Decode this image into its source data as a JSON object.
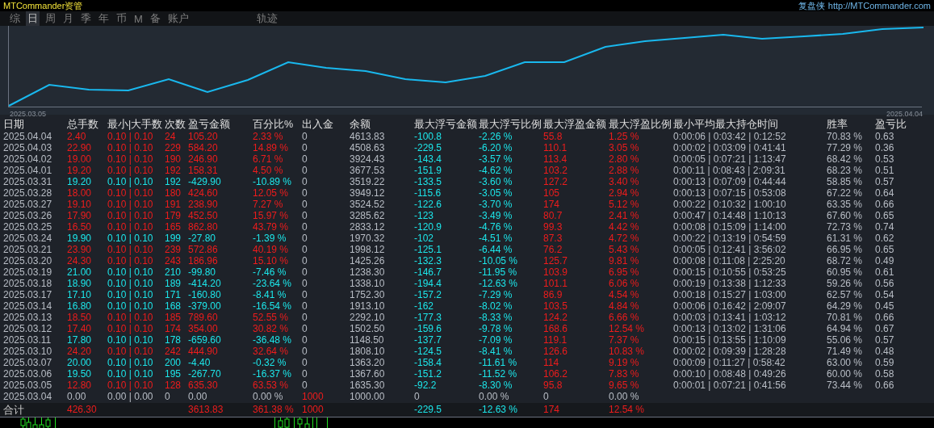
{
  "title": "MTCommander资管",
  "header_right": {
    "label": "复盘侠",
    "link": "http://MTCommander.com"
  },
  "tabs": [
    {
      "label": "综",
      "selected": false
    },
    {
      "label": "日",
      "selected": true
    },
    {
      "label": "周",
      "selected": false
    },
    {
      "label": "月",
      "selected": false
    },
    {
      "label": "季",
      "selected": false
    },
    {
      "label": "年",
      "selected": false
    },
    {
      "label": "币",
      "selected": false
    },
    {
      "label": "M",
      "selected": false
    },
    {
      "label": "备",
      "selected": false
    },
    {
      "label": "账户",
      "selected": false
    }
  ],
  "track_tab": {
    "label": "轨迹",
    "selected": false
  },
  "chart": {
    "start_label": "2025.03.05",
    "end_label": "2025.04.04"
  },
  "table": {
    "columns": [
      "日期",
      "总手数",
      "最小|大手数",
      "次数",
      "盈亏金额",
      "百分比%",
      "出入金",
      "余额",
      "最大浮亏金额",
      "最大浮亏比例",
      "最大浮盈金额",
      "最大浮盈比例",
      "最小平均最大持仓时间",
      "胜率",
      "盈亏比"
    ],
    "rows": [
      {
        "kind": "profit",
        "deposit": false,
        "cells": [
          "2025.04.04",
          "2.40",
          "0.10 | 0.10",
          "24",
          "105.20",
          "2.33 %",
          "0",
          "4613.83",
          "-100.8",
          "-2.26 %",
          "55.8",
          "1.25 %",
          "0:00:06 | 0:03:42 | 0:12:52",
          "70.83 %",
          "0.63"
        ]
      },
      {
        "kind": "profit",
        "deposit": false,
        "cells": [
          "2025.04.03",
          "22.90",
          "0.10 | 0.10",
          "229",
          "584.20",
          "14.89 %",
          "0",
          "4508.63",
          "-229.5",
          "-6.20 %",
          "110.1",
          "3.05 %",
          "0:00:02 | 0:03:09 | 0:41:41",
          "77.29 %",
          "0.36"
        ]
      },
      {
        "kind": "profit",
        "deposit": false,
        "cells": [
          "2025.04.02",
          "19.00",
          "0.10 | 0.10",
          "190",
          "246.90",
          "6.71 %",
          "0",
          "3924.43",
          "-143.4",
          "-3.57 %",
          "113.4",
          "2.80 %",
          "0:00:05 | 0:07:21 | 1:13:47",
          "68.42 %",
          "0.53"
        ]
      },
      {
        "kind": "profit",
        "deposit": false,
        "cells": [
          "2025.04.01",
          "19.20",
          "0.10 | 0.10",
          "192",
          "158.31",
          "4.50 %",
          "0",
          "3677.53",
          "-151.9",
          "-4.62 %",
          "103.2",
          "2.88 %",
          "0:00:11 | 0:08:43 | 2:09:31",
          "68.23 %",
          "0.51"
        ]
      },
      {
        "kind": "loss",
        "deposit": false,
        "cells": [
          "2025.03.31",
          "19.20",
          "0.10 | 0.10",
          "192",
          "-429.90",
          "-10.89 %",
          "0",
          "3519.22",
          "-133.5",
          "-3.60 %",
          "127.2",
          "3.40 %",
          "0:00:13 | 0:07:09 | 0:44:44",
          "58.85 %",
          "0.57"
        ]
      },
      {
        "kind": "profit",
        "deposit": false,
        "cells": [
          "2025.03.28",
          "18.00",
          "0.10 | 0.10",
          "180",
          "424.60",
          "12.05 %",
          "0",
          "3949.12",
          "-115.6",
          "-3.05 %",
          "105",
          "2.94 %",
          "0:00:13 | 0:07:15 | 0:53:08",
          "67.22 %",
          "0.64"
        ]
      },
      {
        "kind": "profit",
        "deposit": false,
        "cells": [
          "2025.03.27",
          "19.10",
          "0.10 | 0.10",
          "191",
          "238.90",
          "7.27 %",
          "0",
          "3524.52",
          "-122.6",
          "-3.70 %",
          "174",
          "5.12 %",
          "0:00:22 | 0:10:32 | 1:00:10",
          "63.35 %",
          "0.66"
        ]
      },
      {
        "kind": "profit",
        "deposit": false,
        "cells": [
          "2025.03.26",
          "17.90",
          "0.10 | 0.10",
          "179",
          "452.50",
          "15.97 %",
          "0",
          "3285.62",
          "-123",
          "-3.49 %",
          "80.7",
          "2.41 %",
          "0:00:47 | 0:14:48 | 1:10:13",
          "67.60 %",
          "0.65"
        ]
      },
      {
        "kind": "profit",
        "deposit": false,
        "cells": [
          "2025.03.25",
          "16.50",
          "0.10 | 0.10",
          "165",
          "862.80",
          "43.79 %",
          "0",
          "2833.12",
          "-120.9",
          "-4.76 %",
          "99.3",
          "4.42 %",
          "0:00:08 | 0:15:09 | 1:14:00",
          "72.73 %",
          "0.74"
        ]
      },
      {
        "kind": "loss",
        "deposit": false,
        "cells": [
          "2025.03.24",
          "19.90",
          "0.10 | 0.10",
          "199",
          "-27.80",
          "-1.39 %",
          "0",
          "1970.32",
          "-102",
          "-4.51 %",
          "87.3",
          "4.72 %",
          "0:00:22 | 0:13:19 | 0:54:59",
          "61.31 %",
          "0.62"
        ]
      },
      {
        "kind": "profit",
        "deposit": false,
        "cells": [
          "2025.03.21",
          "23.90",
          "0.10 | 0.10",
          "239",
          "572.86",
          "40.19 %",
          "0",
          "1998.12",
          "-125.1",
          "-6.44 %",
          "76.2",
          "5.43 %",
          "0:00:05 | 0:12:41 | 3:56:02",
          "66.95 %",
          "0.65"
        ]
      },
      {
        "kind": "profit",
        "deposit": false,
        "cells": [
          "2025.03.20",
          "24.30",
          "0.10 | 0.10",
          "243",
          "186.96",
          "15.10 %",
          "0",
          "1425.26",
          "-132.3",
          "-10.05 %",
          "125.7",
          "9.81 %",
          "0:00:08 | 0:11:08 | 2:25:20",
          "68.72 %",
          "0.49"
        ]
      },
      {
        "kind": "loss",
        "deposit": false,
        "cells": [
          "2025.03.19",
          "21.00",
          "0.10 | 0.10",
          "210",
          "-99.80",
          "-7.46 %",
          "0",
          "1238.30",
          "-146.7",
          "-11.95 %",
          "103.9",
          "6.95 %",
          "0:00:15 | 0:10:55 | 0:53:25",
          "60.95 %",
          "0.61"
        ]
      },
      {
        "kind": "loss",
        "deposit": false,
        "cells": [
          "2025.03.18",
          "18.90",
          "0.10 | 0.10",
          "189",
          "-414.20",
          "-23.64 %",
          "0",
          "1338.10",
          "-194.4",
          "-12.63 %",
          "101.1",
          "6.06 %",
          "0:00:19 | 0:13:38 | 1:12:33",
          "59.26 %",
          "0.56"
        ]
      },
      {
        "kind": "loss",
        "deposit": false,
        "cells": [
          "2025.03.17",
          "17.10",
          "0.10 | 0.10",
          "171",
          "-160.80",
          "-8.41 %",
          "0",
          "1752.30",
          "-157.2",
          "-7.29 %",
          "86.9",
          "4.54 %",
          "0:00:18 | 0:15:27 | 1:03:00",
          "62.57 %",
          "0.54"
        ]
      },
      {
        "kind": "loss",
        "deposit": false,
        "cells": [
          "2025.03.14",
          "16.80",
          "0.10 | 0.10",
          "168",
          "-379.00",
          "-16.54 %",
          "0",
          "1913.10",
          "-162",
          "-8.02 %",
          "103.5",
          "4.84 %",
          "0:00:06 | 0:16:42 | 2:09:07",
          "64.29 %",
          "0.45"
        ]
      },
      {
        "kind": "profit",
        "deposit": false,
        "cells": [
          "2025.03.13",
          "18.50",
          "0.10 | 0.10",
          "185",
          "789.60",
          "52.55 %",
          "0",
          "2292.10",
          "-177.3",
          "-8.33 %",
          "124.2",
          "6.66 %",
          "0:00:03 | 0:13:41 | 1:03:12",
          "70.81 %",
          "0.66"
        ]
      },
      {
        "kind": "profit",
        "deposit": false,
        "cells": [
          "2025.03.12",
          "17.40",
          "0.10 | 0.10",
          "174",
          "354.00",
          "30.82 %",
          "0",
          "1502.50",
          "-159.6",
          "-9.78 %",
          "168.6",
          "12.54 %",
          "0:00:13 | 0:13:02 | 1:31:06",
          "64.94 %",
          "0.67"
        ]
      },
      {
        "kind": "loss",
        "deposit": false,
        "cells": [
          "2025.03.11",
          "17.80",
          "0.10 | 0.10",
          "178",
          "-659.60",
          "-36.48 %",
          "0",
          "1148.50",
          "-137.7",
          "-7.09 %",
          "119.1",
          "7.37 %",
          "0:00:15 | 0:13:55 | 1:10:09",
          "55.06 %",
          "0.57"
        ]
      },
      {
        "kind": "profit",
        "deposit": false,
        "cells": [
          "2025.03.10",
          "24.20",
          "0.10 | 0.10",
          "242",
          "444.90",
          "32.64 %",
          "0",
          "1808.10",
          "-124.5",
          "-8.41 %",
          "126.6",
          "10.83 %",
          "0:00:02 | 0:09:39 | 1:28:28",
          "71.49 %",
          "0.48"
        ]
      },
      {
        "kind": "loss",
        "deposit": false,
        "cells": [
          "2025.03.07",
          "20.00",
          "0.10 | 0.10",
          "200",
          "-4.40",
          "-0.32 %",
          "0",
          "1363.20",
          "-158.4",
          "-11.61 %",
          "114",
          "9.19 %",
          "0:00:09 | 0:11:27 | 0:58:42",
          "63.00 %",
          "0.59"
        ]
      },
      {
        "kind": "loss",
        "deposit": false,
        "cells": [
          "2025.03.06",
          "19.50",
          "0.10 | 0.10",
          "195",
          "-267.70",
          "-16.37 %",
          "0",
          "1367.60",
          "-151.2",
          "-11.52 %",
          "106.2",
          "7.83 %",
          "0:00:10 | 0:08:48 | 0:49:26",
          "60.00 %",
          "0.58"
        ]
      },
      {
        "kind": "profit",
        "deposit": false,
        "cells": [
          "2025.03.05",
          "12.80",
          "0.10 | 0.10",
          "128",
          "635.30",
          "63.53 %",
          "0",
          "1635.30",
          "-92.2",
          "-8.30 %",
          "95.8",
          "9.65 %",
          "0:00:01 | 0:07:21 | 0:41:56",
          "73.44 %",
          "0.66"
        ]
      },
      {
        "kind": "flat",
        "deposit": true,
        "cells": [
          "2025.03.04",
          "0.00",
          "0.00 | 0.00",
          "0",
          "0.00",
          "0.00 %",
          "1000",
          "1000.00",
          "0",
          "0.00 %",
          "0",
          "0.00 %"
        ]
      }
    ],
    "totals": {
      "label": "合计",
      "kind": "profit",
      "deposit": true,
      "total_lots": "426.30",
      "pnl": "3613.83",
      "percent": "361.38 %",
      "deposit_total": "1000",
      "max_float_loss": "-229.5",
      "max_float_loss_pct": "-12.63 %",
      "max_float_profit": "174",
      "max_float_profit_pct": "12.54 %"
    }
  }
}
